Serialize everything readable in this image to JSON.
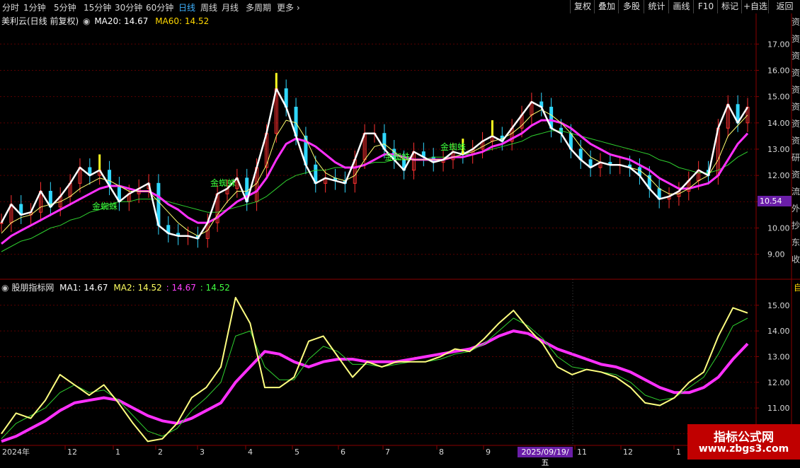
{
  "toolbar": {
    "periods": [
      "分时",
      "1分钟",
      "5分钟",
      "15分钟",
      "30分钟",
      "60分钟",
      "日线",
      "周线",
      "月线",
      "多周期",
      "更多"
    ],
    "active_period": "日线",
    "tools": [
      "复权",
      "叠加",
      "多股",
      "统计",
      "画线",
      "F10",
      "标记",
      "+自选",
      "返回"
    ]
  },
  "main_panel": {
    "title": "美利云(日线 前复权)",
    "ma20_label": "MA20: 14.67",
    "ma60_label": "MA60: 14.52",
    "ma20_color": "#ffffff",
    "ma60_color": "#ffd800",
    "cursor_price": "10.54",
    "signal_label": "金蜘蛛",
    "signal_color": "#3cff3c"
  },
  "sub_panel": {
    "title": "股朋指标网",
    "ma1_label": "MA1: 14.67",
    "ma2_label": "MA2: 14.52",
    "extra1": ": 14.67",
    "extra2": ": 14.52",
    "right_tag": "自"
  },
  "x_axis": {
    "year_label": "2024年",
    "month_labels": [
      "12",
      "1",
      "2",
      "3",
      "4",
      "5",
      "6",
      "7",
      "8",
      "9",
      "11",
      "12",
      "1"
    ],
    "cursor_date": "2025/09/19/五"
  },
  "watermark": {
    "line1": "指标公式网",
    "line2": "www.zbgs3.com"
  },
  "right_strip": {
    "glyphs": [
      "资",
      "资",
      "资",
      "资",
      "资",
      "资",
      "资",
      "资",
      "研",
      "资",
      "流",
      "外",
      "抄",
      "东",
      "收"
    ]
  },
  "chart_data": {
    "type": "line",
    "main": {
      "ylim": [
        8.4,
        17.6
      ],
      "y_ticks": [
        9.0,
        10.0,
        11.0,
        12.0,
        13.0,
        14.0,
        15.0,
        16.0,
        17.0
      ],
      "close": [
        10.2,
        10.9,
        10.5,
        10.6,
        11.4,
        10.8,
        11.2,
        11.7,
        12.3,
        12.0,
        12.2,
        11.6,
        11.0,
        11.3,
        11.5,
        11.7,
        10.1,
        9.8,
        9.7,
        9.7,
        9.6,
        10.2,
        11.3,
        11.5,
        11.9,
        11.0,
        12.3,
        13.6,
        15.3,
        14.6,
        13.5,
        12.4,
        11.7,
        11.9,
        11.8,
        11.7,
        12.6,
        13.6,
        13.6,
        13.0,
        12.6,
        12.2,
        12.9,
        12.7,
        12.5,
        12.6,
        12.9,
        12.8,
        13.0,
        13.3,
        13.5,
        13.3,
        13.8,
        14.3,
        14.8,
        14.6,
        13.8,
        13.6,
        13.0,
        12.6,
        12.3,
        12.5,
        12.4,
        12.4,
        12.3,
        12.0,
        11.5,
        11.1,
        11.2,
        11.4,
        11.8,
        12.2,
        12.0,
        13.8,
        14.7,
        14.0,
        14.6
      ],
      "ma_fast": [
        9.8,
        10.2,
        10.4,
        10.5,
        10.8,
        10.9,
        11.0,
        11.2,
        11.5,
        11.7,
        11.9,
        11.8,
        11.6,
        11.4,
        11.4,
        11.4,
        11.0,
        10.6,
        10.2,
        9.9,
        9.7,
        9.9,
        10.5,
        11.0,
        11.4,
        11.4,
        11.7,
        12.4,
        13.5,
        14.1,
        14.0,
        13.4,
        12.6,
        12.1,
        11.9,
        11.8,
        12.0,
        12.6,
        13.1,
        13.2,
        12.9,
        12.6,
        12.6,
        12.6,
        12.6,
        12.6,
        12.7,
        12.8,
        12.9,
        13.1,
        13.3,
        13.4,
        13.6,
        13.9,
        14.3,
        14.5,
        14.3,
        14.0,
        13.6,
        13.1,
        12.7,
        12.5,
        12.4,
        12.4,
        12.3,
        12.2,
        11.9,
        11.5,
        11.3,
        11.3,
        11.5,
        11.8,
        12.0,
        12.6,
        13.5,
        13.9,
        14.3
      ],
      "ma20": [
        9.4,
        9.7,
        9.9,
        10.1,
        10.3,
        10.5,
        10.7,
        10.9,
        11.1,
        11.3,
        11.5,
        11.6,
        11.6,
        11.5,
        11.4,
        11.4,
        11.2,
        10.9,
        10.7,
        10.4,
        10.2,
        10.2,
        10.4,
        10.7,
        11.0,
        11.2,
        11.4,
        11.9,
        12.6,
        13.2,
        13.4,
        13.3,
        13.1,
        12.8,
        12.5,
        12.3,
        12.3,
        12.4,
        12.6,
        12.8,
        12.8,
        12.7,
        12.6,
        12.6,
        12.6,
        12.6,
        12.7,
        12.7,
        12.8,
        12.9,
        13.1,
        13.2,
        13.4,
        13.6,
        13.9,
        14.1,
        14.1,
        14.0,
        13.8,
        13.5,
        13.2,
        13.0,
        12.8,
        12.7,
        12.6,
        12.4,
        12.2,
        11.9,
        11.7,
        11.5,
        11.5,
        11.6,
        11.7,
        12.0,
        12.6,
        13.2,
        13.6
      ],
      "ma60": [
        9.1,
        9.3,
        9.5,
        9.6,
        9.8,
        10.0,
        10.1,
        10.3,
        10.4,
        10.6,
        10.7,
        10.9,
        11.0,
        11.0,
        11.1,
        11.1,
        11.1,
        11.0,
        10.9,
        10.8,
        10.7,
        10.6,
        10.6,
        10.7,
        10.8,
        10.9,
        11.0,
        11.2,
        11.5,
        11.8,
        12.0,
        12.1,
        12.2,
        12.2,
        12.3,
        12.3,
        12.3,
        12.4,
        12.5,
        12.5,
        12.6,
        12.6,
        12.6,
        12.6,
        12.7,
        12.7,
        12.7,
        12.8,
        12.8,
        12.9,
        13.0,
        13.1,
        13.2,
        13.3,
        13.5,
        13.6,
        13.7,
        13.7,
        13.6,
        13.5,
        13.4,
        13.3,
        13.2,
        13.1,
        13.0,
        12.9,
        12.8,
        12.6,
        12.5,
        12.3,
        12.2,
        12.1,
        12.1,
        12.2,
        12.4,
        12.7,
        12.9
      ]
    },
    "sub": {
      "ylim": [
        9.6,
        15.6
      ],
      "y_ticks": [
        10.0,
        11.0,
        12.0,
        13.0,
        14.0,
        15.0
      ],
      "ma1": [
        10.0,
        10.8,
        10.6,
        11.3,
        12.3,
        11.9,
        11.5,
        11.9,
        11.2,
        10.4,
        9.7,
        9.8,
        10.4,
        11.4,
        11.8,
        12.6,
        15.3,
        14.3,
        11.8,
        11.8,
        12.2,
        13.6,
        13.8,
        13.0,
        12.2,
        12.8,
        12.6,
        12.8,
        12.8,
        12.8,
        13.0,
        13.3,
        13.2,
        13.7,
        14.3,
        14.8,
        14.1,
        13.5,
        12.6,
        12.3,
        12.5,
        12.4,
        12.2,
        11.8,
        11.2,
        11.1,
        11.4,
        12.0,
        12.4,
        13.8,
        14.9,
        14.7
      ],
      "ma2": [
        9.8,
        10.4,
        10.7,
        11.0,
        11.6,
        11.9,
        11.6,
        11.7,
        11.3,
        10.7,
        10.1,
        9.9,
        10.2,
        10.9,
        11.4,
        12.0,
        13.8,
        14.0,
        12.6,
        12.1,
        12.1,
        12.9,
        13.4,
        13.2,
        12.7,
        12.7,
        12.6,
        12.7,
        12.8,
        12.8,
        12.9,
        13.1,
        13.2,
        13.5,
        14.0,
        14.5,
        14.2,
        13.7,
        13.0,
        12.6,
        12.5,
        12.4,
        12.3,
        12.0,
        11.5,
        11.3,
        11.4,
        11.8,
        12.2,
        13.1,
        14.2,
        14.5
      ],
      "ma3": [
        9.7,
        9.9,
        10.2,
        10.5,
        10.9,
        11.2,
        11.3,
        11.4,
        11.3,
        11.0,
        10.7,
        10.5,
        10.4,
        10.6,
        10.9,
        11.2,
        12.0,
        12.6,
        13.2,
        13.1,
        12.8,
        12.6,
        12.8,
        12.9,
        12.9,
        12.8,
        12.8,
        12.8,
        12.9,
        13.0,
        13.1,
        13.2,
        13.3,
        13.5,
        13.8,
        14.0,
        13.9,
        13.6,
        13.3,
        13.1,
        12.9,
        12.7,
        12.6,
        12.4,
        12.1,
        11.8,
        11.6,
        11.6,
        11.8,
        12.2,
        12.9,
        13.5
      ]
    }
  }
}
